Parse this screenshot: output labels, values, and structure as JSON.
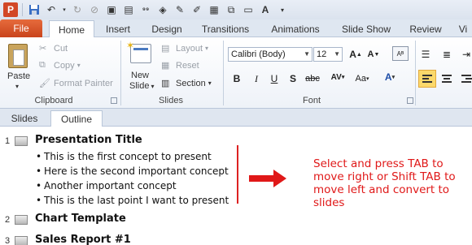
{
  "ribbon_tabs": [
    "File",
    "Home",
    "Insert",
    "Design",
    "Transitions",
    "Animations",
    "Slide Show",
    "Review",
    "Vi"
  ],
  "clipboard": {
    "paste": "Paste",
    "cut": "Cut",
    "copy": "Copy",
    "format_painter": "Format Painter",
    "label": "Clipboard"
  },
  "slides": {
    "new_slide_1": "New",
    "new_slide_2": "Slide",
    "layout": "Layout",
    "reset": "Reset",
    "section": "Section",
    "label": "Slides"
  },
  "font": {
    "family": "Calibri (Body)",
    "size": "12",
    "label": "Font"
  },
  "pane_tabs": {
    "slides": "Slides",
    "outline": "Outline"
  },
  "outline": [
    {
      "num": "1",
      "title": "Presentation Title",
      "bullets": [
        "This is the first concept to present",
        "Here is the second important concept",
        "Another important concept",
        "This is the last point I want to present"
      ]
    },
    {
      "num": "2",
      "title": "Chart Template",
      "bullets": []
    },
    {
      "num": "3",
      "title": "Sales Report #1",
      "bullets": []
    }
  ],
  "annotation": "Select and press TAB to move right or Shift TAB to move left and convert to slides",
  "colors": {
    "accent_red": "#e01818",
    "file_tab": "#d24726",
    "ribbon_bg": "#dfe7f1"
  }
}
